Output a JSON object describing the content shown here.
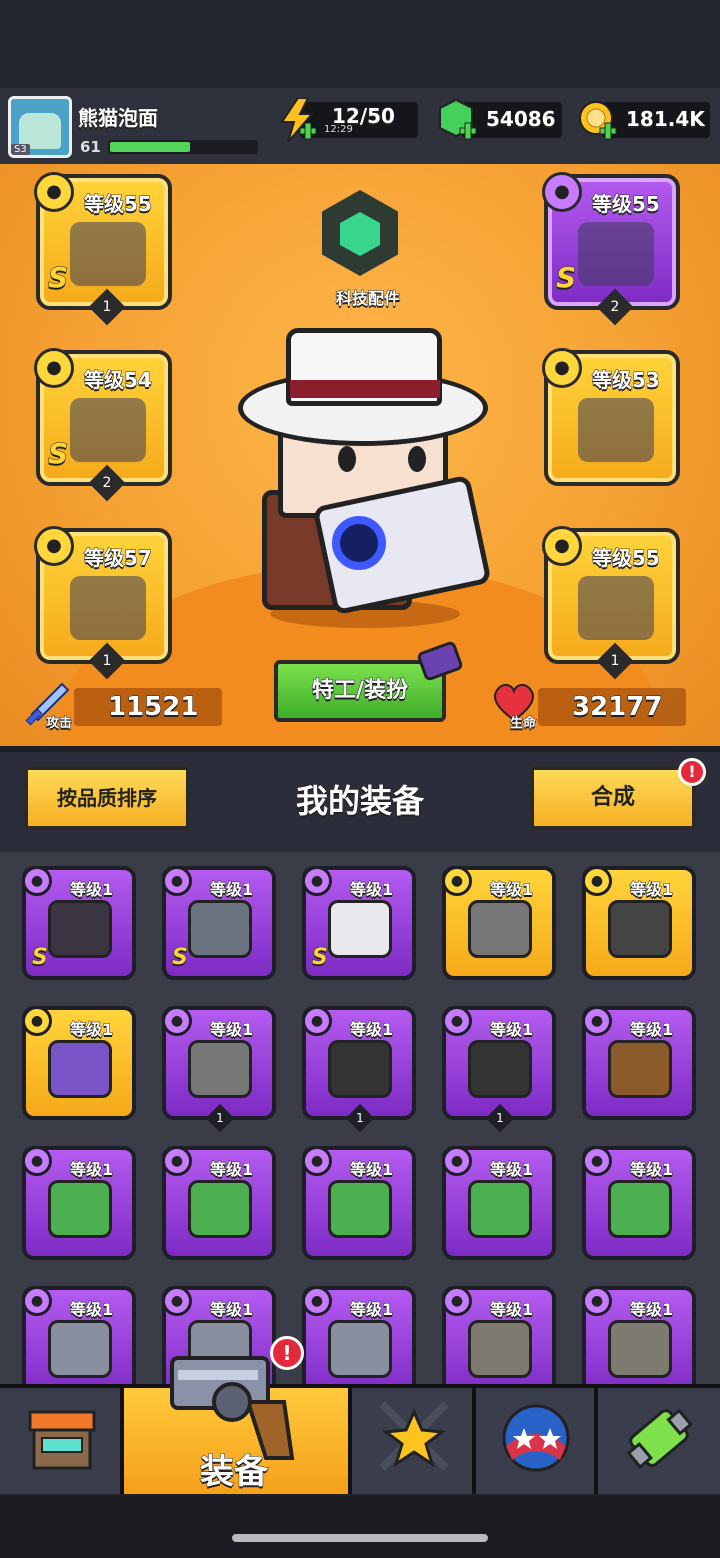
{
  "player": {
    "name": "熊猫泡面",
    "level": "61",
    "tag": "S3",
    "xp_fraction": 0.55
  },
  "resources": {
    "energy": "12/50",
    "energy_timer": "12:29",
    "gems": "54086",
    "coins": "181.4K"
  },
  "tech": {
    "label": "科技配件"
  },
  "slots": [
    {
      "lv": "等级55",
      "rank": "S",
      "count": "1",
      "rarity": "gold",
      "icon": "gun-icon"
    },
    {
      "lv": "等级55",
      "rank": "S",
      "count": "2",
      "rarity": "purple",
      "icon": "armor-icon"
    },
    {
      "lv": "等级54",
      "rank": "S",
      "count": "2",
      "rarity": "gold",
      "icon": "ring-icon"
    },
    {
      "lv": "等级53",
      "rank": "",
      "count": "",
      "rarity": "gold",
      "icon": "belt-icon"
    },
    {
      "lv": "等级57",
      "rank": "",
      "count": "1",
      "rarity": "gold",
      "icon": "glove-icon"
    },
    {
      "lv": "等级55",
      "rank": "",
      "count": "1",
      "rarity": "gold",
      "icon": "boot-icon"
    }
  ],
  "stats": {
    "attack_label": "攻击",
    "attack": "11521",
    "hp_label": "生命",
    "hp": "32177"
  },
  "agent_button": "特工/装扮",
  "equip": {
    "sort_label": "按品质排序",
    "title": "我的装备",
    "merge_label": "合成",
    "alert": "!"
  },
  "grid": [
    {
      "lv": "等级1",
      "rank": "S",
      "count": "",
      "rarity": "purple",
      "icon": "armor-icon",
      "color": "#3a3540"
    },
    {
      "lv": "等级1",
      "rank": "S",
      "count": "",
      "rarity": "purple",
      "icon": "belt-icon",
      "color": "#6a7380"
    },
    {
      "lv": "等级1",
      "rank": "S",
      "count": "",
      "rarity": "purple",
      "icon": "boot-icon",
      "color": "#e8e8ee"
    },
    {
      "lv": "等级1",
      "rank": "",
      "count": "",
      "rarity": "gold",
      "icon": "kunai-icon",
      "color": "#777"
    },
    {
      "lv": "等级1",
      "rank": "",
      "count": "",
      "rarity": "gold",
      "icon": "belt-icon",
      "color": "#444"
    },
    {
      "lv": "等级1",
      "rank": "",
      "count": "",
      "rarity": "gold",
      "icon": "boot-icon",
      "color": "#7a55c8"
    },
    {
      "lv": "等级1",
      "rank": "",
      "count": "1",
      "rarity": "purple",
      "icon": "kunai-icon",
      "color": "#777"
    },
    {
      "lv": "等级1",
      "rank": "",
      "count": "1",
      "rarity": "purple",
      "icon": "belt-icon",
      "color": "#333"
    },
    {
      "lv": "等级1",
      "rank": "",
      "count": "1",
      "rarity": "purple",
      "icon": "belt-icon",
      "color": "#333"
    },
    {
      "lv": "等级1",
      "rank": "",
      "count": "",
      "rarity": "purple",
      "icon": "shotgun-icon",
      "color": "#8a5a2a"
    },
    {
      "lv": "等级1",
      "rank": "",
      "count": "",
      "rarity": "purple",
      "icon": "armor-icon",
      "color": "#4caf50"
    },
    {
      "lv": "等级1",
      "rank": "",
      "count": "",
      "rarity": "purple",
      "icon": "armor-icon",
      "color": "#4caf50"
    },
    {
      "lv": "等级1",
      "rank": "",
      "count": "",
      "rarity": "purple",
      "icon": "armor-icon",
      "color": "#4caf50"
    },
    {
      "lv": "等级1",
      "rank": "",
      "count": "",
      "rarity": "purple",
      "icon": "armor-icon",
      "color": "#4caf50"
    },
    {
      "lv": "等级1",
      "rank": "",
      "count": "",
      "rarity": "purple",
      "icon": "armor-icon",
      "color": "#4caf50"
    },
    {
      "lv": "等级1",
      "rank": "",
      "count": "",
      "rarity": "purple",
      "icon": "armor-icon",
      "color": "#8a8fa0"
    },
    {
      "lv": "等级1",
      "rank": "",
      "count": "",
      "rarity": "purple",
      "icon": "armor-icon",
      "color": "#8a8fa0"
    },
    {
      "lv": "等级1",
      "rank": "",
      "count": "",
      "rarity": "purple",
      "icon": "armor-icon",
      "color": "#8a8fa0"
    },
    {
      "lv": "等级1",
      "rank": "",
      "count": "",
      "rarity": "purple",
      "icon": "armor-icon",
      "color": "#7d7a70"
    },
    {
      "lv": "等级1",
      "rank": "",
      "count": "",
      "rarity": "purple",
      "icon": "armor-icon",
      "color": "#7d7a70"
    }
  ],
  "nav": [
    {
      "name": "shop-tab",
      "icon": "shop-icon",
      "label": ""
    },
    {
      "name": "equipment-tab",
      "icon": "revolver-icon",
      "label": "装备"
    },
    {
      "name": "battle-tab",
      "icon": "star-swords-icon",
      "label": ""
    },
    {
      "name": "talent-tab",
      "icon": "orb-icon",
      "label": ""
    },
    {
      "name": "lab-tab",
      "icon": "dna-icon",
      "label": ""
    }
  ]
}
